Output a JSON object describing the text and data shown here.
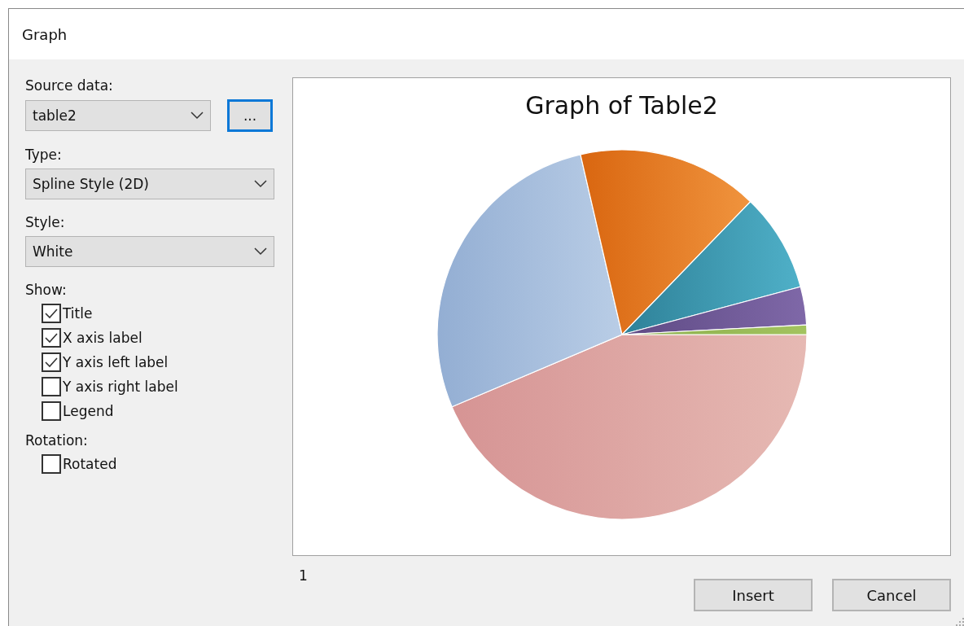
{
  "window": {
    "title": "Graph"
  },
  "source": {
    "label": "Source data:",
    "value": "table2",
    "browse": "..."
  },
  "type": {
    "label": "Type:",
    "value": "Spline Style (2D)"
  },
  "style": {
    "label": "Style:",
    "value": "White"
  },
  "show": {
    "label": "Show:",
    "options": [
      {
        "label": "Title",
        "checked": true
      },
      {
        "label": "X axis label",
        "checked": true
      },
      {
        "label": "Y axis left label",
        "checked": true
      },
      {
        "label": "Y axis right label",
        "checked": false
      },
      {
        "label": "Legend",
        "checked": false
      }
    ]
  },
  "rotation": {
    "label": "Rotation:",
    "options": [
      {
        "label": "Rotated",
        "checked": false
      }
    ]
  },
  "preview": {
    "title": "Graph of Table2",
    "page": "1"
  },
  "buttons": [
    "Insert",
    "Cancel"
  ]
}
